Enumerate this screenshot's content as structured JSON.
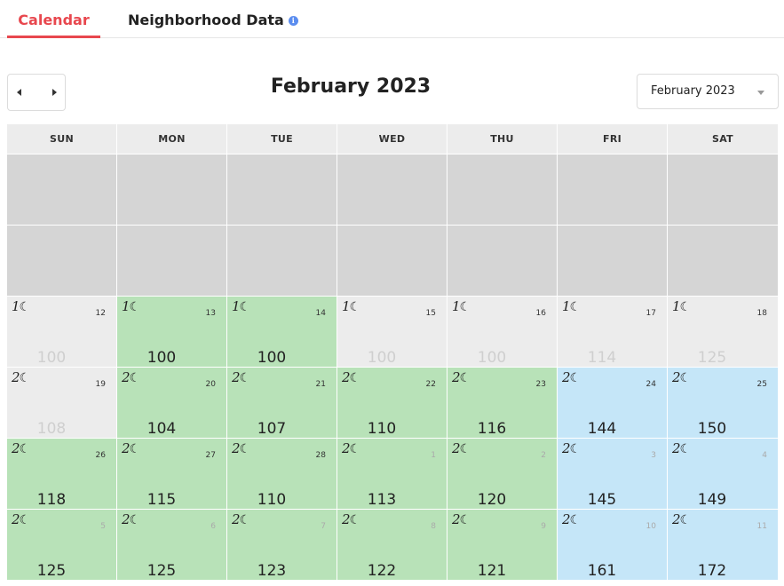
{
  "tabs": [
    {
      "label": "Calendar",
      "active": true
    },
    {
      "label": "Neighborhood Data",
      "active": false,
      "info_icon": "info-icon"
    }
  ],
  "info_glyph": "i",
  "title": "February 2023",
  "month_select": {
    "selected": "February 2023"
  },
  "weekdays": [
    "SUN",
    "MON",
    "TUE",
    "WED",
    "THU",
    "FRI",
    "SAT"
  ],
  "colors": {
    "accent": "#e8474e",
    "available_green": "#b8e2b8",
    "available_blue": "#c5e6f8",
    "unavailable_gray": "#ececec",
    "blank": "#d5d5d5"
  },
  "weeks": [
    {
      "days": [
        null,
        null,
        null,
        null,
        null,
        null,
        null
      ]
    },
    {
      "days": [
        null,
        null,
        null,
        null,
        null,
        null,
        null
      ]
    },
    {
      "days": [
        {
          "day": "12",
          "nights": "1",
          "price": "100",
          "status": "gray"
        },
        {
          "day": "13",
          "nights": "1",
          "price": "100",
          "status": "green"
        },
        {
          "day": "14",
          "nights": "1",
          "price": "100",
          "status": "green"
        },
        {
          "day": "15",
          "nights": "1",
          "price": "100",
          "status": "gray"
        },
        {
          "day": "16",
          "nights": "1",
          "price": "100",
          "status": "gray"
        },
        {
          "day": "17",
          "nights": "1",
          "price": "114",
          "status": "gray"
        },
        {
          "day": "18",
          "nights": "1",
          "price": "125",
          "status": "gray"
        }
      ]
    },
    {
      "days": [
        {
          "day": "19",
          "nights": "2",
          "price": "108",
          "status": "gray"
        },
        {
          "day": "20",
          "nights": "2",
          "price": "104",
          "status": "green"
        },
        {
          "day": "21",
          "nights": "2",
          "price": "107",
          "status": "green"
        },
        {
          "day": "22",
          "nights": "2",
          "price": "110",
          "status": "green"
        },
        {
          "day": "23",
          "nights": "2",
          "price": "116",
          "status": "green"
        },
        {
          "day": "24",
          "nights": "2",
          "price": "144",
          "status": "blue"
        },
        {
          "day": "25",
          "nights": "2",
          "price": "150",
          "status": "blue"
        }
      ]
    },
    {
      "days": [
        {
          "day": "26",
          "nights": "2",
          "price": "118",
          "status": "green"
        },
        {
          "day": "27",
          "nights": "2",
          "price": "115",
          "status": "green"
        },
        {
          "day": "28",
          "nights": "2",
          "price": "110",
          "status": "green"
        },
        {
          "day": "1",
          "nights": "2",
          "price": "113",
          "status": "green",
          "next_month": true
        },
        {
          "day": "2",
          "nights": "2",
          "price": "120",
          "status": "green",
          "next_month": true
        },
        {
          "day": "3",
          "nights": "2",
          "price": "145",
          "status": "blue",
          "next_month": true
        },
        {
          "day": "4",
          "nights": "2",
          "price": "149",
          "status": "blue",
          "next_month": true
        }
      ]
    },
    {
      "days": [
        {
          "day": "5",
          "nights": "2",
          "price": "125",
          "status": "green",
          "next_month": true
        },
        {
          "day": "6",
          "nights": "2",
          "price": "125",
          "status": "green",
          "next_month": true
        },
        {
          "day": "7",
          "nights": "2",
          "price": "123",
          "status": "green",
          "next_month": true
        },
        {
          "day": "8",
          "nights": "2",
          "price": "122",
          "status": "green",
          "next_month": true
        },
        {
          "day": "9",
          "nights": "2",
          "price": "121",
          "status": "green",
          "next_month": true
        },
        {
          "day": "10",
          "nights": "2",
          "price": "161",
          "status": "blue",
          "next_month": true
        },
        {
          "day": "11",
          "nights": "2",
          "price": "172",
          "status": "blue",
          "next_month": true
        }
      ]
    }
  ]
}
